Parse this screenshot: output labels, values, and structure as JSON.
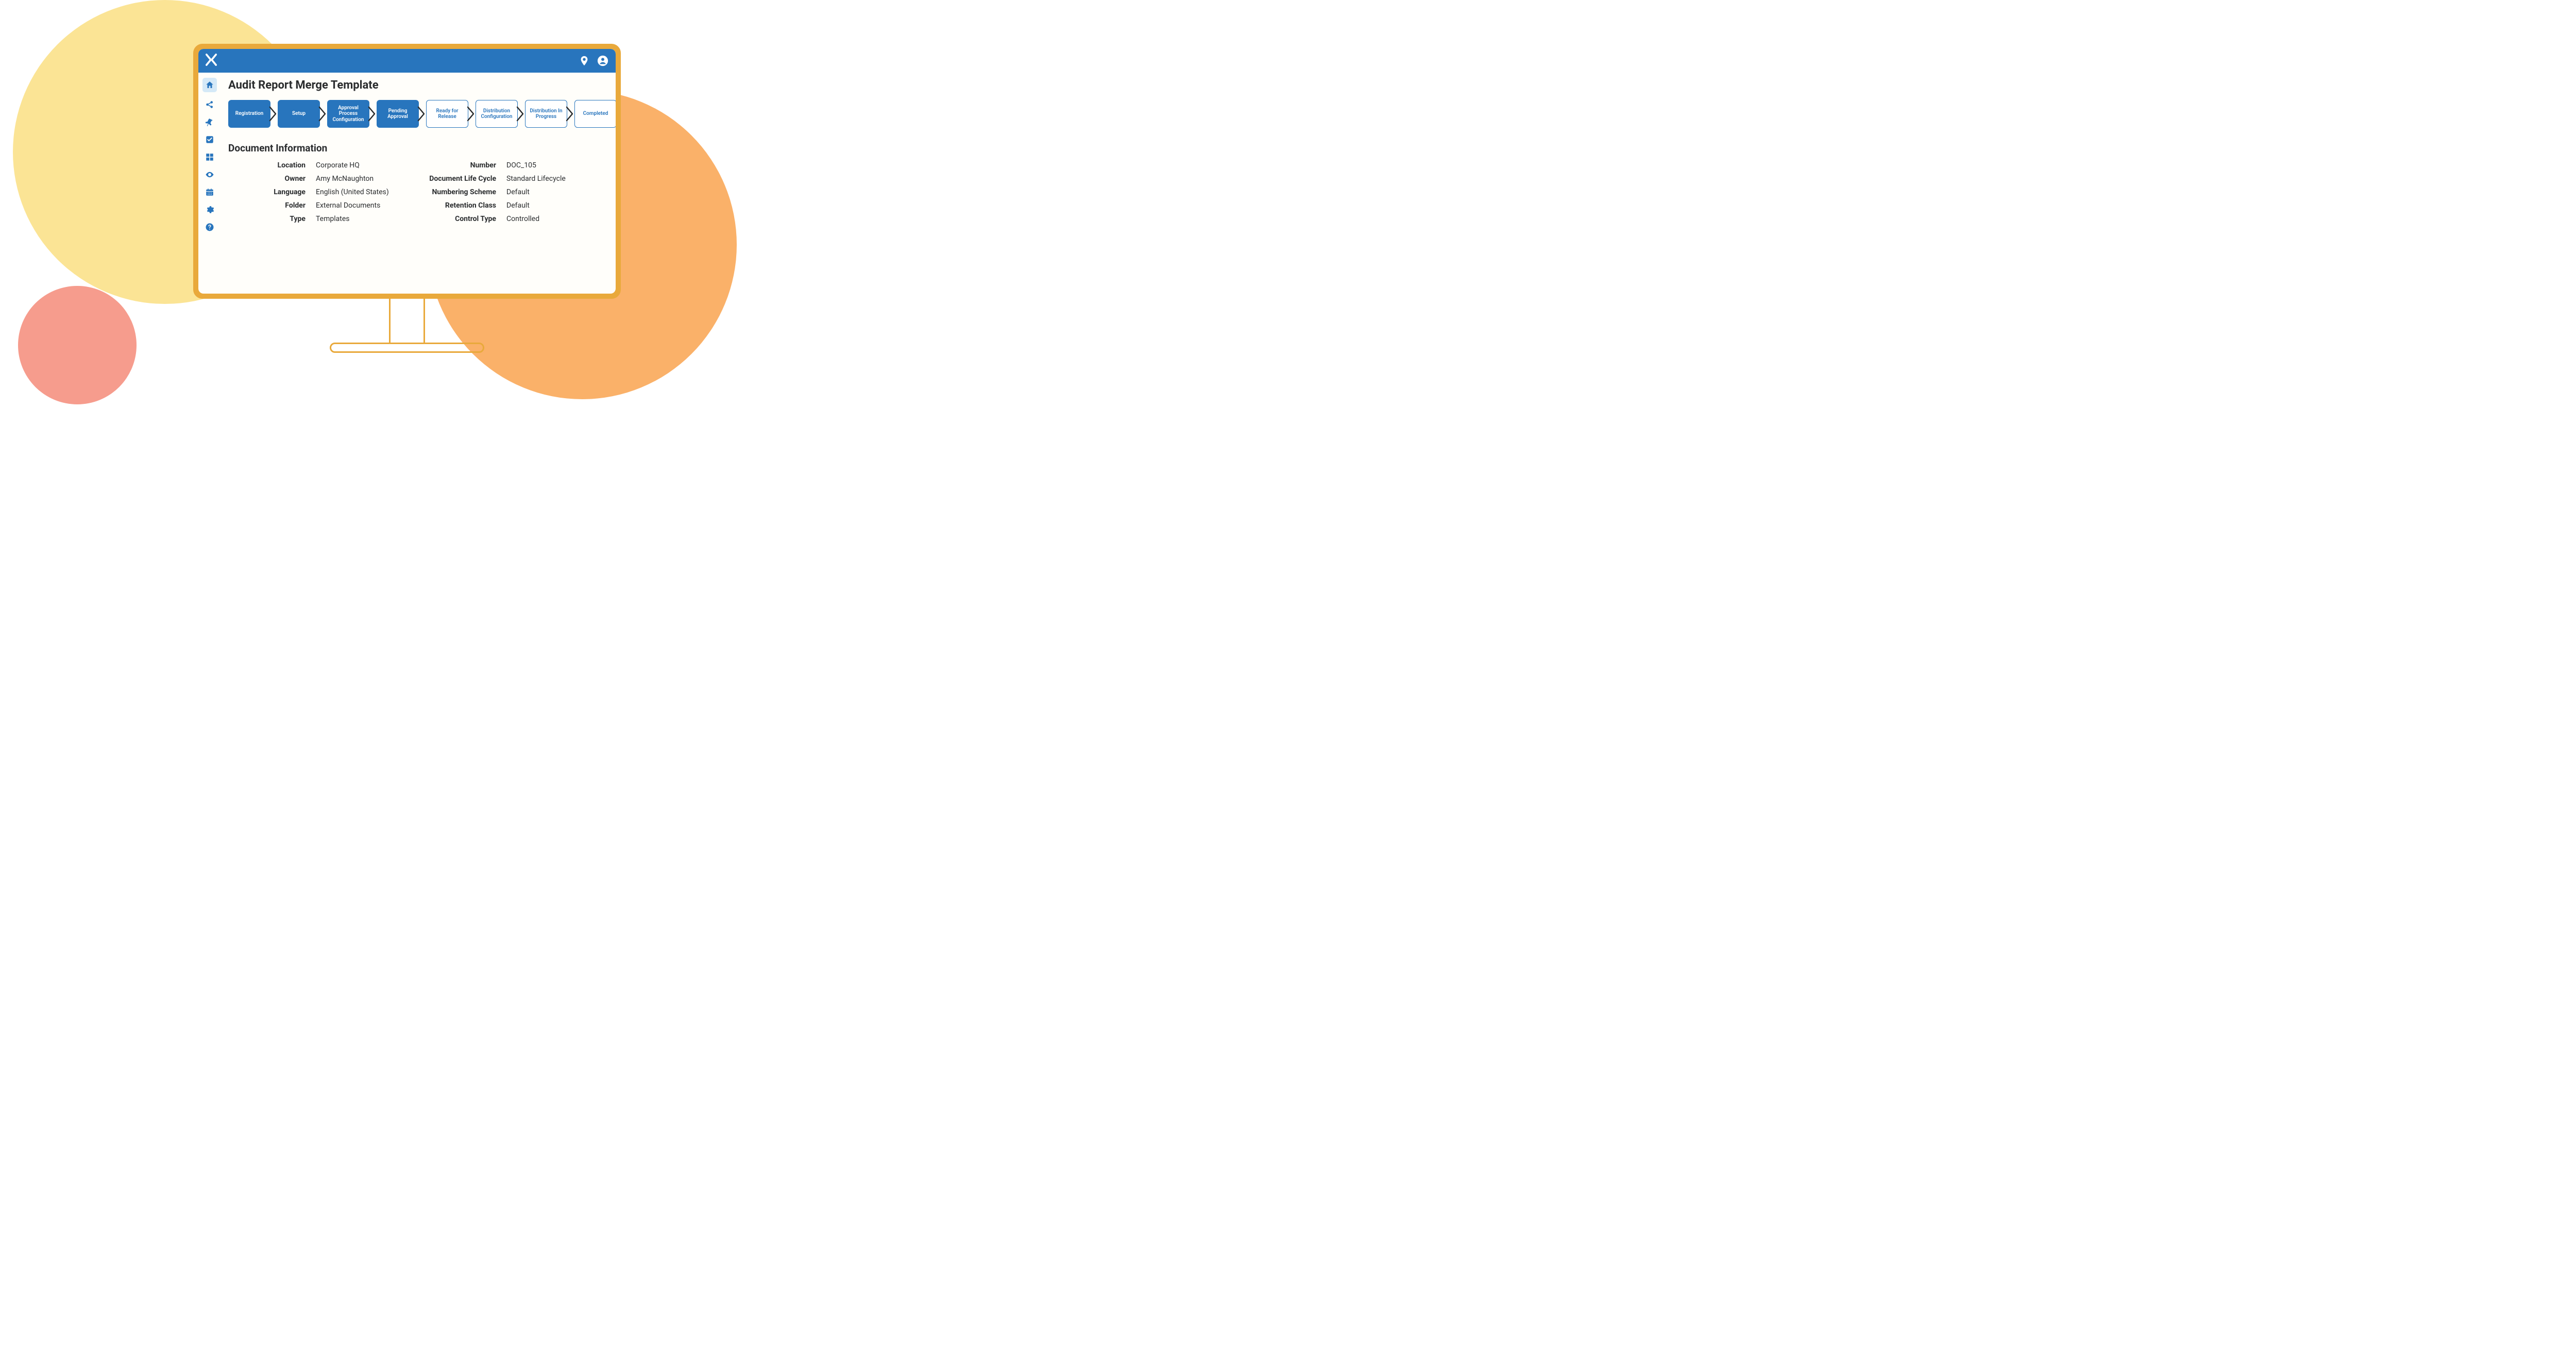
{
  "page": {
    "title": "Audit Report Merge Template",
    "section_title": "Document Information"
  },
  "workflow": {
    "steps": [
      {
        "label": "Registration",
        "state": "filled"
      },
      {
        "label": "Setup",
        "state": "filled"
      },
      {
        "label": "Approval Process Configuration",
        "state": "filled"
      },
      {
        "label": "Pending Approval",
        "state": "filled"
      },
      {
        "label": "Ready for Release",
        "state": "outlined"
      },
      {
        "label": "Distribution Configuration",
        "state": "outlined"
      },
      {
        "label": "Distribution In Progress",
        "state": "outlined"
      },
      {
        "label": "Completed",
        "state": "outlined"
      }
    ]
  },
  "doc_info": {
    "col1": [
      {
        "label": "Location",
        "value": "Corporate HQ"
      },
      {
        "label": "Owner",
        "value": "Amy McNaughton"
      },
      {
        "label": "Language",
        "value": "English (United States)"
      },
      {
        "label": "Folder",
        "value": "External Documents"
      },
      {
        "label": "Type",
        "value": "Templates"
      }
    ],
    "col2": [
      {
        "label": "Number",
        "value": "DOC_105"
      },
      {
        "label": "Document Life Cycle",
        "value": "Standard Lifecycle"
      },
      {
        "label": "Numbering Scheme",
        "value": "Default"
      },
      {
        "label": "Retention Class",
        "value": "Default"
      },
      {
        "label": "Control Type",
        "value": "Controlled"
      }
    ]
  },
  "sidebar": {
    "items": [
      {
        "name": "home-icon",
        "active": true
      },
      {
        "name": "share-icon",
        "active": false
      },
      {
        "name": "pin-icon",
        "active": false
      },
      {
        "name": "check-square-icon",
        "active": false
      },
      {
        "name": "grid-icon",
        "active": false
      },
      {
        "name": "eye-icon",
        "active": false
      },
      {
        "name": "calendar-icon",
        "active": false
      },
      {
        "name": "gear-icon",
        "active": false
      },
      {
        "name": "help-icon",
        "active": false
      }
    ]
  },
  "header": {
    "icons": [
      {
        "name": "location-pin-icon"
      },
      {
        "name": "user-account-icon"
      }
    ]
  },
  "colors": {
    "primary": "#2875bd",
    "monitor_stroke": "#e9a93b",
    "bg_yellow": "#fbe495",
    "bg_orange": "#fab169",
    "bg_pink": "#f69c8d"
  }
}
